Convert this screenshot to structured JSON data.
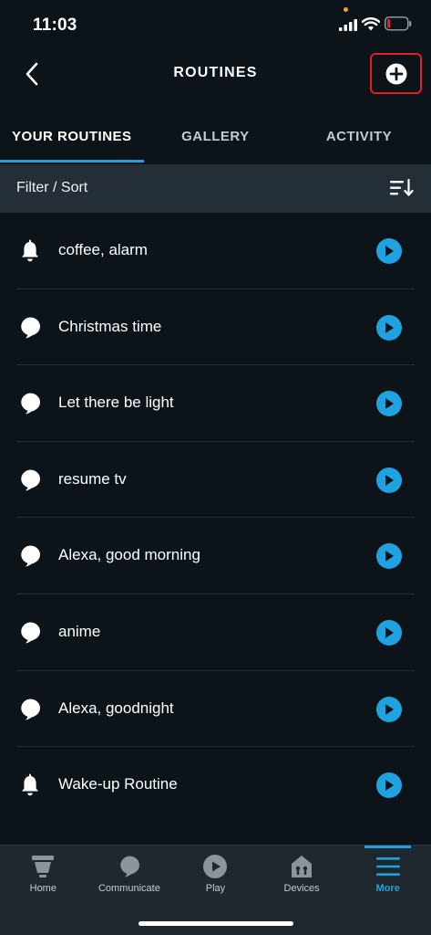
{
  "status_bar": {
    "time": "11:03"
  },
  "header": {
    "title": "ROUTINES"
  },
  "tabs": [
    {
      "label": "YOUR ROUTINES",
      "active": true
    },
    {
      "label": "GALLERY",
      "active": false
    },
    {
      "label": "ACTIVITY",
      "active": false
    }
  ],
  "filter": {
    "label": "Filter / Sort"
  },
  "routines": [
    {
      "name": "coffee, alarm",
      "icon": "bell-icon"
    },
    {
      "name": "Christmas time",
      "icon": "speech-bubble-icon"
    },
    {
      "name": "Let there be light",
      "icon": "speech-bubble-icon"
    },
    {
      "name": "resume tv",
      "icon": "speech-bubble-icon"
    },
    {
      "name": "Alexa, good morning",
      "icon": "speech-bubble-icon"
    },
    {
      "name": "anime",
      "icon": "speech-bubble-icon"
    },
    {
      "name": "Alexa, goodnight",
      "icon": "speech-bubble-icon"
    },
    {
      "name": "Wake-up Routine",
      "icon": "bell-icon"
    }
  ],
  "bottom_nav": [
    {
      "label": "Home",
      "icon": "home-icon",
      "active": false
    },
    {
      "label": "Communicate",
      "icon": "chat-icon",
      "active": false
    },
    {
      "label": "Play",
      "icon": "play-icon",
      "active": false
    },
    {
      "label": "Devices",
      "icon": "devices-icon",
      "active": false
    },
    {
      "label": "More",
      "icon": "menu-icon",
      "active": true
    }
  ],
  "colors": {
    "background": "#0d1419",
    "accent": "#1fa3e0",
    "filter_bar": "#242e37",
    "highlight_box": "#e01e25",
    "battery_low": "#e01e25"
  }
}
